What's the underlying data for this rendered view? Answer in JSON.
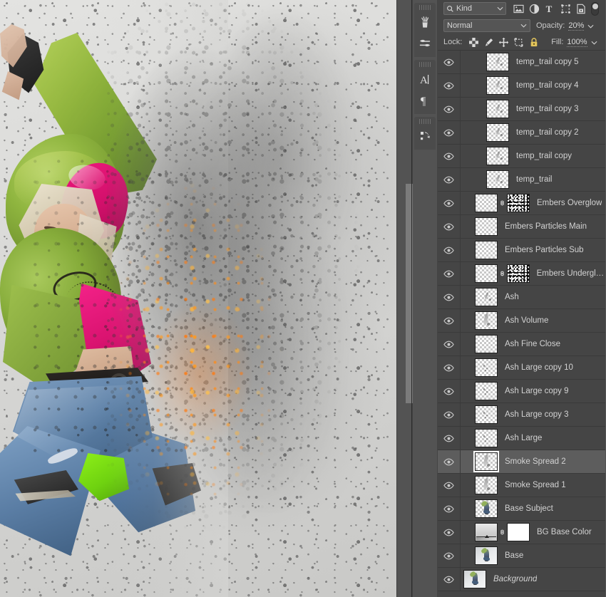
{
  "canvas": {
    "artwork_description": "Dancer in green hoodie, pink cap and top, blue jeans with dispersion ash and ember effect"
  },
  "dock": {
    "groups": [
      {
        "items": [
          {
            "name": "brushes-panel-icon",
            "label": "Brushes"
          },
          {
            "name": "brush-settings-panel-icon",
            "label": "Brush Settings"
          }
        ]
      },
      {
        "items": [
          {
            "name": "character-panel-icon",
            "label": "Character"
          },
          {
            "name": "paragraph-panel-icon",
            "label": "Paragraph"
          }
        ]
      },
      {
        "items": [
          {
            "name": "history-panel-icon",
            "label": "History"
          }
        ]
      }
    ]
  },
  "layers_panel": {
    "filter": {
      "kind_label": "Kind",
      "icons": [
        {
          "name": "filter-pixel-icon",
          "label": "Pixel Layers"
        },
        {
          "name": "filter-adjustment-icon",
          "label": "Adjustment Layers"
        },
        {
          "name": "filter-type-icon",
          "label": "Type Layers"
        },
        {
          "name": "filter-shape-icon",
          "label": "Shape Layers"
        },
        {
          "name": "filter-smart-object-icon",
          "label": "Smart Objects"
        }
      ],
      "toggle_label": "Turn layer filtering on/off"
    },
    "blend": {
      "mode": "Normal",
      "opacity_label": "Opacity:",
      "opacity_value": "20%"
    },
    "lock": {
      "label": "Lock:",
      "icons": [
        {
          "name": "lock-transparent-pixels-icon",
          "label": "Lock transparent pixels"
        },
        {
          "name": "lock-image-pixels-icon",
          "label": "Lock image pixels"
        },
        {
          "name": "lock-position-icon",
          "label": "Lock position"
        },
        {
          "name": "lock-artboard-nesting-icon",
          "label": "Prevent auto-nesting"
        },
        {
          "name": "lock-all-icon",
          "label": "Lock all"
        }
      ],
      "fill_label": "Fill:",
      "fill_value": "100%"
    },
    "layers": [
      {
        "name": "temp_trail copy 5",
        "visible": true,
        "selected": false,
        "indent": 1,
        "thumb": "transparent-wisp",
        "mask": null,
        "italic": false
      },
      {
        "name": "temp_trail copy 4",
        "visible": true,
        "selected": false,
        "indent": 1,
        "thumb": "transparent-wisp",
        "mask": null,
        "italic": false
      },
      {
        "name": "temp_trail copy 3",
        "visible": true,
        "selected": false,
        "indent": 1,
        "thumb": "transparent-wisp",
        "mask": null,
        "italic": false
      },
      {
        "name": "temp_trail copy 2",
        "visible": true,
        "selected": false,
        "indent": 1,
        "thumb": "transparent-wisp",
        "mask": null,
        "italic": false
      },
      {
        "name": "temp_trail copy",
        "visible": true,
        "selected": false,
        "indent": 1,
        "thumb": "transparent-wisp",
        "mask": null,
        "italic": false
      },
      {
        "name": "temp_trail",
        "visible": true,
        "selected": false,
        "indent": 1,
        "thumb": "transparent-wisp",
        "mask": null,
        "italic": false
      },
      {
        "name": "Embers Overglow",
        "visible": true,
        "selected": false,
        "indent": 0,
        "thumb": "transparent-empty",
        "mask": "noise",
        "italic": false
      },
      {
        "name": "Embers Particles Main",
        "visible": true,
        "selected": false,
        "indent": 0,
        "thumb": "transparent-empty",
        "mask": null,
        "italic": false
      },
      {
        "name": "Embers Particles Sub",
        "visible": true,
        "selected": false,
        "indent": 0,
        "thumb": "transparent-empty",
        "mask": null,
        "italic": false
      },
      {
        "name": "Embers Underglow",
        "visible": true,
        "selected": false,
        "indent": 0,
        "thumb": "transparent-empty",
        "mask": "noise",
        "italic": false
      },
      {
        "name": "Ash",
        "visible": true,
        "selected": false,
        "indent": 0,
        "thumb": "transparent-wisp",
        "mask": null,
        "italic": false
      },
      {
        "name": "Ash Volume",
        "visible": true,
        "selected": false,
        "indent": 0,
        "thumb": "transparent-smoke",
        "mask": null,
        "italic": false
      },
      {
        "name": "Ash Fine Close",
        "visible": true,
        "selected": false,
        "indent": 0,
        "thumb": "transparent-empty",
        "mask": null,
        "italic": false
      },
      {
        "name": "Ash Large copy 10",
        "visible": true,
        "selected": false,
        "indent": 0,
        "thumb": "transparent-speck",
        "mask": null,
        "italic": false
      },
      {
        "name": "Ash Large copy 9",
        "visible": true,
        "selected": false,
        "indent": 0,
        "thumb": "transparent-speck",
        "mask": null,
        "italic": false
      },
      {
        "name": "Ash Large copy 3",
        "visible": true,
        "selected": false,
        "indent": 0,
        "thumb": "transparent-speck",
        "mask": null,
        "italic": false
      },
      {
        "name": "Ash Large",
        "visible": true,
        "selected": false,
        "indent": 0,
        "thumb": "transparent-speck",
        "mask": null,
        "italic": false
      },
      {
        "name": "Smoke Spread 2",
        "visible": true,
        "selected": true,
        "indent": 0,
        "thumb": "transparent-smoke",
        "mask": null,
        "italic": false
      },
      {
        "name": "Smoke Spread 1",
        "visible": true,
        "selected": false,
        "indent": 0,
        "thumb": "transparent-smoke",
        "mask": null,
        "italic": false
      },
      {
        "name": "Base Subject",
        "visible": true,
        "selected": false,
        "indent": 0,
        "thumb": "subject",
        "mask": null,
        "italic": false
      },
      {
        "name": "BG Base Color",
        "visible": true,
        "selected": false,
        "indent": 0,
        "thumb": "gradient",
        "mask": "white",
        "italic": false
      },
      {
        "name": "Base",
        "visible": true,
        "selected": false,
        "indent": 0,
        "thumb": "base-photo",
        "mask": null,
        "italic": false
      },
      {
        "name": "Background",
        "visible": true,
        "selected": false,
        "indent": -1,
        "thumb": "base-photo",
        "mask": null,
        "italic": true
      }
    ]
  },
  "scrollbar": {
    "name": "canvas-vertical-scrollbar"
  },
  "colors": {
    "panel_bg": "#454545",
    "row_selected": "#5d5d5d",
    "text": "#d2d2d2",
    "field_bg": "#555555"
  }
}
